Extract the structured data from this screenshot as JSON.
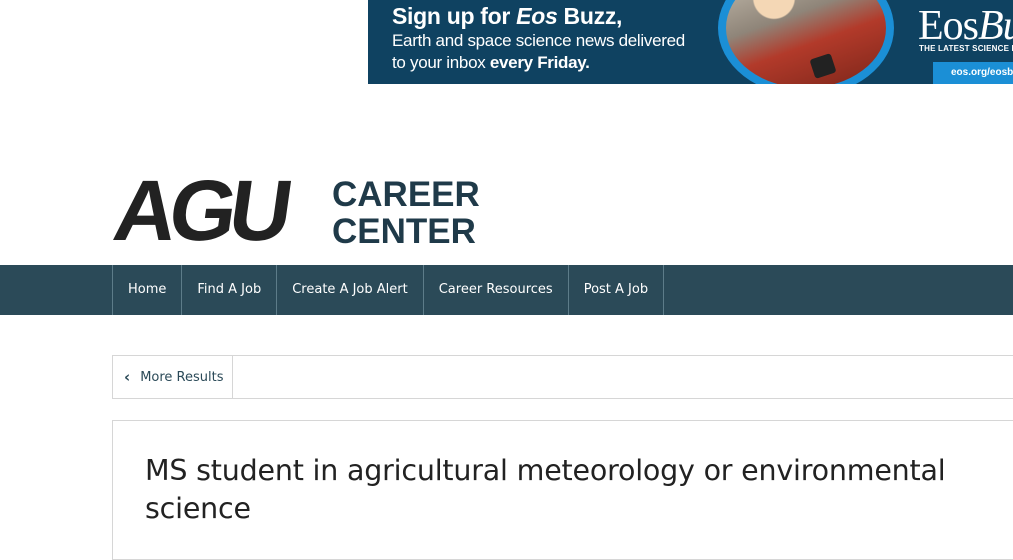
{
  "ad": {
    "headline_prefix": "Sign up for ",
    "headline_em": "Eos",
    "headline_suffix": " Buzz,",
    "line1": "Earth and space science news delivered",
    "line2_prefix": "to your inbox ",
    "line2_bold": "every Friday.",
    "brand_prefix": "Eos",
    "brand_suffix": "Bu",
    "tagline": "THE LATEST SCIENCE NE",
    "url": "eos.org/eosb",
    "colors": {
      "background": "#0f4261",
      "accent": "#1b8fd6"
    }
  },
  "logo": {
    "mark": "AGU",
    "line1": "CAREER",
    "line2": "CENTER"
  },
  "nav": {
    "items": [
      {
        "label": "Home"
      },
      {
        "label": "Find A Job"
      },
      {
        "label": "Create A Job Alert"
      },
      {
        "label": "Career Resources"
      },
      {
        "label": "Post A Job"
      }
    ],
    "color": "#2b4a58"
  },
  "results": {
    "more_label": "More Results",
    "icon": "chevron-left-icon"
  },
  "job": {
    "title": "MS student in agricultural meteorology or environmental science"
  }
}
